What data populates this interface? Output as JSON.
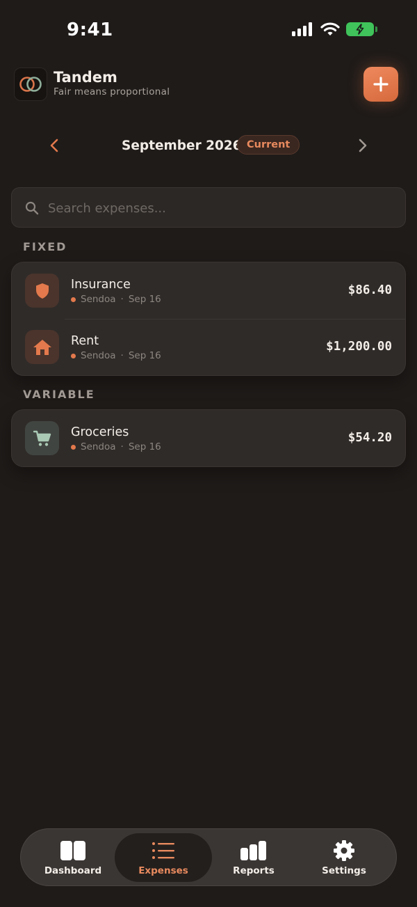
{
  "status_bar": {
    "time": "9:41"
  },
  "header": {
    "app_name": "Tandem",
    "tagline": "Fair means proportional"
  },
  "month_nav": {
    "label": "September 2026",
    "badge": "Current"
  },
  "search": {
    "placeholder": "Search expenses..."
  },
  "sections": [
    {
      "label": "FIXED",
      "items": [
        {
          "title": "Insurance",
          "person": "Sendoa",
          "date": "Sep 16",
          "amount": "$86.40",
          "icon": "shield-icon"
        },
        {
          "title": "Rent",
          "person": "Sendoa",
          "date": "Sep 16",
          "amount": "$1,200.00",
          "icon": "house-icon"
        }
      ]
    },
    {
      "label": "VARIABLE",
      "items": [
        {
          "title": "Groceries",
          "person": "Sendoa",
          "date": "Sep 16",
          "amount": "$54.20",
          "icon": "cart-icon"
        }
      ]
    }
  ],
  "tabs": [
    {
      "label": "Dashboard",
      "icon": "dashboard-icon",
      "active": false
    },
    {
      "label": "Expenses",
      "icon": "list-icon",
      "active": true
    },
    {
      "label": "Reports",
      "icon": "bar-chart-icon",
      "active": false
    },
    {
      "label": "Settings",
      "icon": "gear-icon",
      "active": false
    }
  ],
  "colors": {
    "accent": "#e3794c",
    "background": "#1f1b19",
    "card": "#2f2b29",
    "battery": "#3fc35a"
  }
}
